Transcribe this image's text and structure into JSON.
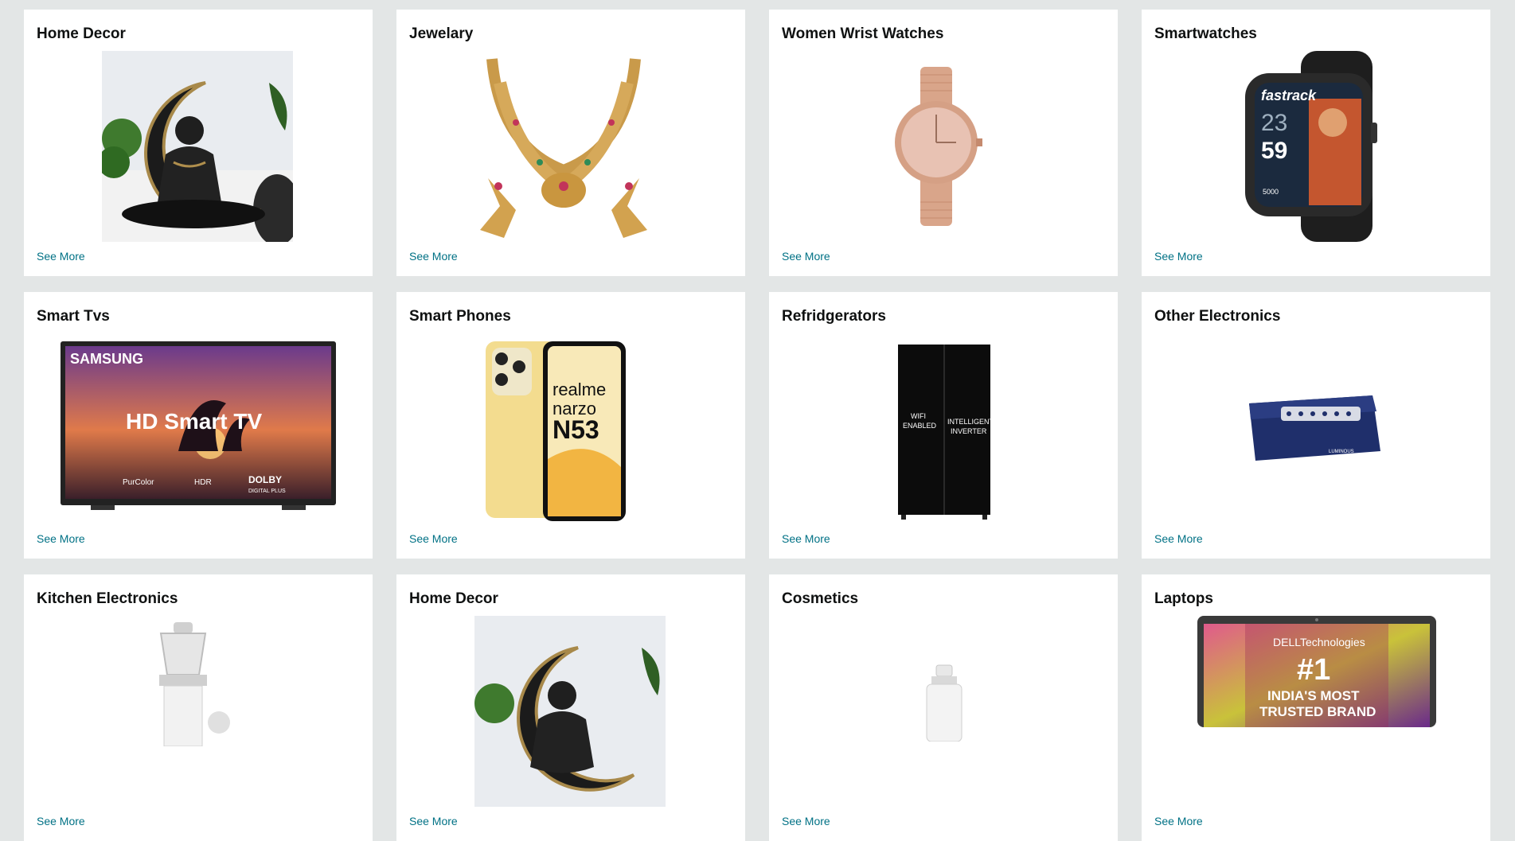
{
  "cards": [
    {
      "title": "Home Decor",
      "link": "See More",
      "image": "buddha-statue-image"
    },
    {
      "title": "Jewelary",
      "link": "See More",
      "image": "gold-necklace-image"
    },
    {
      "title": "Women Wrist Watches",
      "link": "See More",
      "image": "rose-gold-watch-image"
    },
    {
      "title": "Smartwatches",
      "link": "See More",
      "image": "smartwatch-image"
    },
    {
      "title": "Smart Tvs",
      "link": "See More",
      "image": "smart-tv-image"
    },
    {
      "title": "Smart Phones",
      "link": "See More",
      "image": "smartphone-image"
    },
    {
      "title": "Refridgerators",
      "link": "See More",
      "image": "refrigerator-image"
    },
    {
      "title": "Other Electronics",
      "link": "See More",
      "image": "inverter-image"
    },
    {
      "title": "Kitchen Electronics",
      "link": "See More",
      "image": "mixer-grinder-image"
    },
    {
      "title": "Home Decor",
      "link": "See More",
      "image": "buddha-statue-image"
    },
    {
      "title": "Cosmetics",
      "link": "See More",
      "image": "serum-bottle-image"
    },
    {
      "title": "Laptops",
      "link": "See More",
      "image": "laptop-image"
    }
  ],
  "image_text": {
    "watch_brand": "fastrack",
    "watch_time_1": "23",
    "watch_time_2": "59",
    "watch_steps": "5000",
    "tv_brand": "SAMSUNG",
    "tv_headline": "HD Smart TV",
    "tv_purcolor": "PurColor",
    "tv_hdr": "HDR",
    "tv_dolby": "DOLBY",
    "tv_dolby_sub": "DIGITAL PLUS",
    "phone_line1": "realme",
    "phone_line2": "narzo",
    "phone_line3": "N53",
    "fridge_left_1": "WIFI",
    "fridge_left_2": "ENABLED",
    "fridge_right_1": "INTELLIGENT",
    "fridge_right_2": "INVERTER",
    "inverter_brand": "LUMINOUS",
    "laptop_brand": "DELLTechnologies",
    "laptop_rank": "#1",
    "laptop_line1": "INDIA'S MOST",
    "laptop_line2": "TRUSTED BRAND"
  },
  "colors": {
    "page_bg": "#e3e6e6",
    "card_bg": "#ffffff",
    "link": "#007185",
    "title": "#0f1111"
  }
}
